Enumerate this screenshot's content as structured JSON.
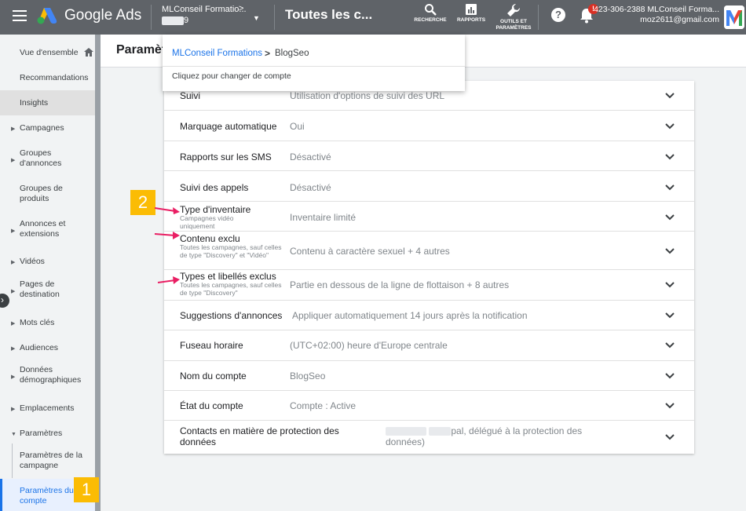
{
  "topbar": {
    "brand": "Google Ads",
    "account_name": "MLConseil Formatio...",
    "account_arrow": ">",
    "account_id": "9",
    "page_heading": "Toutes les c...",
    "tools": [
      {
        "label": "RECHERCHE",
        "icon": "search-icon"
      },
      {
        "label": "RAPPORTS",
        "icon": "reports-icon"
      },
      {
        "label": "OUTILS ET PARAMÈTRES",
        "icon": "wrench-icon"
      }
    ],
    "help": "?",
    "notification_badge": "!",
    "user_line1": "423-306-2388 MLConseil Forma...",
    "user_line2": "moz2611@gmail.com"
  },
  "dropdown": {
    "parent_account": "MLConseil Formations",
    "separator": ">",
    "current_account": "BlogSeo",
    "hint": "Cliquez pour changer de compte"
  },
  "sidebar": {
    "items": [
      {
        "label": "Vue d'ensemble"
      },
      {
        "label": "Recommandations"
      },
      {
        "label": "Insights"
      },
      {
        "label": "Campagnes"
      },
      {
        "label": "Groupes d'annonces"
      },
      {
        "label": "Groupes de produits"
      },
      {
        "label": "Annonces et extensions"
      },
      {
        "label": "Vidéos"
      },
      {
        "label": "Pages de destination"
      },
      {
        "label": "Mots clés"
      },
      {
        "label": "Audiences"
      },
      {
        "label": "Données démographiques"
      },
      {
        "label": "Emplacements"
      },
      {
        "label": "Paramètres"
      },
      {
        "label": "Paramètres de la campagne"
      },
      {
        "label": "Paramètres du compte"
      }
    ]
  },
  "main": {
    "title": "Paramèt"
  },
  "settings": [
    {
      "key": "Suivi",
      "sub": "",
      "value": "Utilisation d'options de suivi des URL"
    },
    {
      "key": "Marquage automatique",
      "sub": "",
      "value": "Oui"
    },
    {
      "key": "Rapports sur les SMS",
      "sub": "",
      "value": "Désactivé"
    },
    {
      "key": "Suivi des appels",
      "sub": "",
      "value": "Désactivé"
    },
    {
      "key": "Type d'inventaire",
      "sub": "Campagnes vidéo uniquement",
      "value": "Inventaire limité"
    },
    {
      "key": "Contenu exclu",
      "sub": "Toutes les campagnes, sauf celles de type \"Discovery\" et \"Vidéo\"",
      "value": "Contenu à caractère sexuel + 4 autres"
    },
    {
      "key": "Types et libellés exclus",
      "sub": "Toutes les campagnes, sauf celles de type \"Discovery\"",
      "value": "Partie en dessous de la ligne de flottaison + 8 autres"
    },
    {
      "key": "Suggestions d'annonces",
      "sub": "",
      "value": "Appliquer automatiquement 14 jours après la notification"
    },
    {
      "key": "Fuseau horaire",
      "sub": "",
      "value": "(UTC+02:00) heure d'Europe centrale"
    },
    {
      "key": "Nom du compte",
      "sub": "",
      "value": "BlogSeo"
    },
    {
      "key": "État du compte",
      "sub": "",
      "value": "Compte : Active"
    },
    {
      "key": "Contacts en matière de protection des données",
      "sub": "",
      "value_line1": "pal, délégué à la protection des",
      "value_line2": "données)"
    }
  ],
  "annotations": {
    "badge1": "1",
    "badge2": "2"
  },
  "colors": {
    "topbar": "#5f6368",
    "accent": "#1a73e8",
    "annotation": "#fbbc04",
    "arrow": "#e91e63"
  }
}
